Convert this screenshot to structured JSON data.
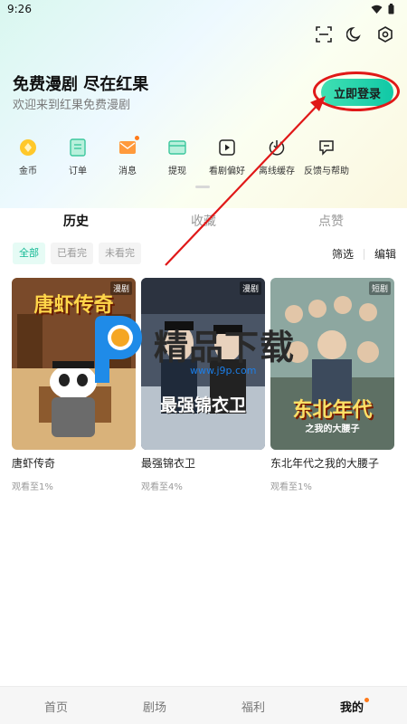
{
  "status_bar": {
    "time": "9:26"
  },
  "header": {
    "title": "免费漫剧 尽在红果",
    "subtitle": "欢迎来到红果免费漫剧",
    "login_label": "立即登录",
    "icons": [
      "scan-icon",
      "dark-mode-icon",
      "settings-icon"
    ]
  },
  "menu": [
    {
      "label": "金币",
      "icon": "coin-icon"
    },
    {
      "label": "订单",
      "icon": "order-icon"
    },
    {
      "label": "消息",
      "icon": "message-icon"
    },
    {
      "label": "提现",
      "icon": "withdraw-icon"
    },
    {
      "label": "看剧偏好",
      "icon": "preference-icon"
    },
    {
      "label": "离线缓存",
      "icon": "offline-cache-icon"
    },
    {
      "label": "反馈与帮助",
      "icon": "feedback-icon"
    }
  ],
  "tabs": [
    {
      "label": "历史",
      "active": true
    },
    {
      "label": "收藏",
      "active": false
    },
    {
      "label": "点赞",
      "active": false
    }
  ],
  "filters": [
    {
      "label": "全部",
      "active": true
    },
    {
      "label": "已看完",
      "active": false
    },
    {
      "label": "未看完",
      "active": false
    }
  ],
  "tools": {
    "filter_label": "筛选",
    "edit_label": "编辑"
  },
  "cards": [
    {
      "title": "唐虾传奇",
      "progress": "观看至1%",
      "badge": "漫剧",
      "poster_title": "唐虾传奇"
    },
    {
      "title": "最强锦衣卫",
      "progress": "观看至4%",
      "badge": "漫剧",
      "poster_title": "最强锦衣卫"
    },
    {
      "title": "东北年代之我的大腰子",
      "progress": "观看至1%",
      "badge": "短剧",
      "poster_title": "东北年代",
      "poster_subtitle": "之我的大腰子"
    }
  ],
  "watermark": {
    "text": "精品下载",
    "url": "www.j9p.com"
  },
  "bottom_nav": [
    {
      "label": "首页",
      "active": false
    },
    {
      "label": "剧场",
      "active": false
    },
    {
      "label": "福利",
      "active": false
    },
    {
      "label": "我的",
      "active": true
    }
  ],
  "colors": {
    "accent": "#14b894",
    "highlight": "#e01818",
    "badge_dot": "#ff7a1a"
  }
}
